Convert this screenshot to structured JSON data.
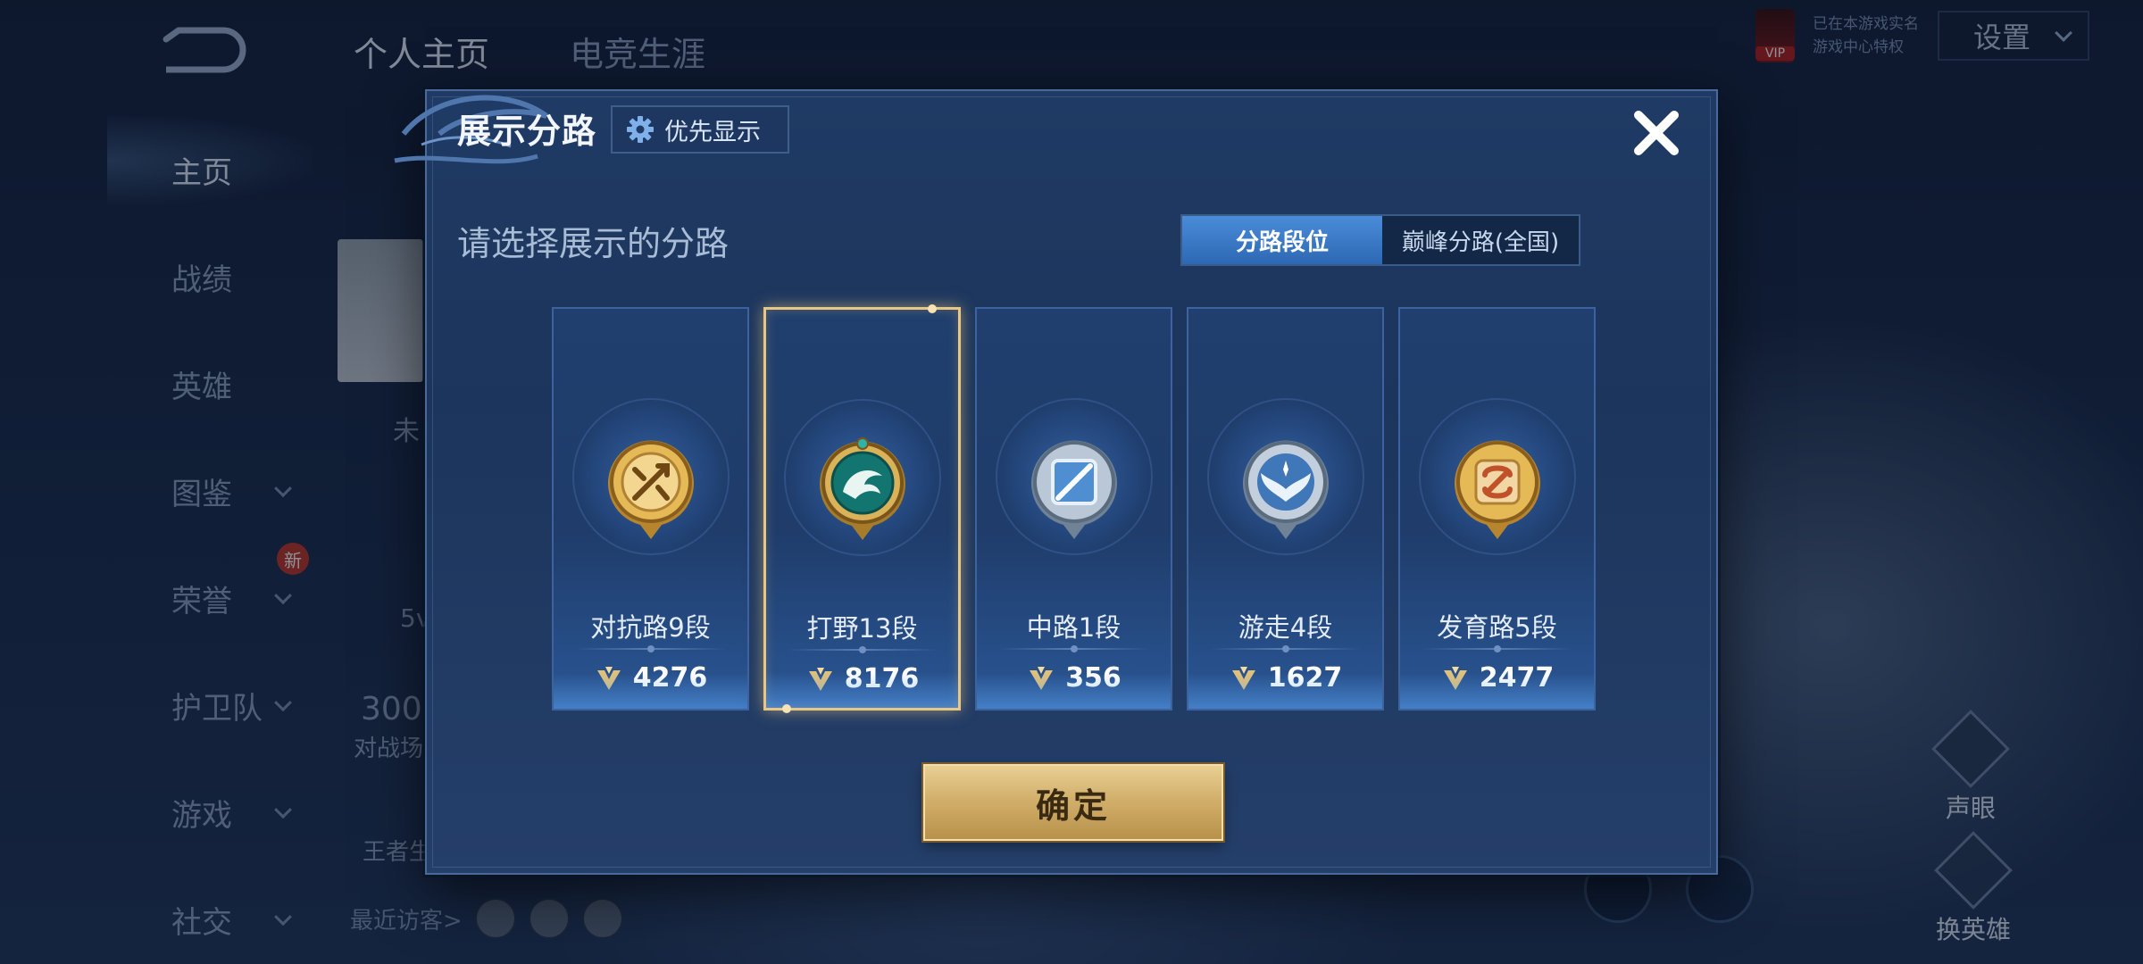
{
  "background": {
    "nav": [
      {
        "label": "主页",
        "active": true,
        "has_chevron": false
      },
      {
        "label": "战绩",
        "active": false,
        "has_chevron": false
      },
      {
        "label": "英雄",
        "active": false,
        "has_chevron": false
      },
      {
        "label": "图鉴",
        "active": false,
        "has_chevron": true
      },
      {
        "label": "荣誉",
        "active": false,
        "has_chevron": true
      },
      {
        "label": "护卫队",
        "active": false,
        "has_chevron": true
      },
      {
        "label": "游戏",
        "active": false,
        "has_chevron": true
      },
      {
        "label": "社交",
        "active": false,
        "has_chevron": true
      }
    ],
    "new_badge": "新",
    "tabs": [
      "个人主页",
      "电竞生涯"
    ],
    "vip_badge": "VIP",
    "vip_text_1": "已在本游戏实名",
    "vip_text_2": "游戏中心特权",
    "settings_label": "设置",
    "left_fragments": {
      "frag_1": "未",
      "frag_2": "5v",
      "frag_3": "300",
      "frag_4": "对战场",
      "frag_5": "王者生"
    },
    "recent_visitors_label": "最近访客>",
    "right_actions": {
      "top": "声眼",
      "bottom": "换英雄"
    }
  },
  "modal": {
    "title": "展示分路",
    "priority_button": "优先显示",
    "subtitle": "请选择展示的分路",
    "segment": {
      "option_1": "分路段位",
      "option_2": "巅峰分路(全国)",
      "selected": "分路段位"
    },
    "lanes": [
      {
        "label": "对抗路9段",
        "points": "4276",
        "emblem": "clash-lane-emblem",
        "color": "#d8a94a",
        "selected": false
      },
      {
        "label": "打野13段",
        "points": "8176",
        "emblem": "jungle-dragon-emblem",
        "color": "#1f8a86",
        "selected": true
      },
      {
        "label": "中路1段",
        "points": "356",
        "emblem": "mid-lane-emblem",
        "color": "#8fb4d8",
        "selected": false
      },
      {
        "label": "游走4段",
        "points": "1627",
        "emblem": "roam-wings-emblem",
        "color": "#a8c2dc",
        "selected": false
      },
      {
        "label": "发育路5段",
        "points": "2477",
        "emblem": "farm-lane-emblem",
        "color": "#d8a94a",
        "selected": false
      }
    ],
    "confirm_button": "确定"
  },
  "colors": {
    "accent_blue": "#3a7acb",
    "gold": "#d6b36f",
    "selection": "#e8c786"
  }
}
